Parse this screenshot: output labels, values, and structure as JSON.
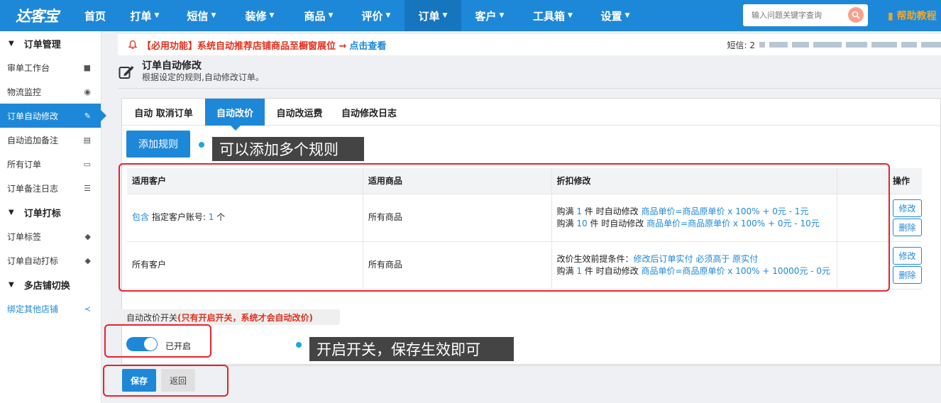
{
  "header": {
    "logo": "达客宝",
    "nav": [
      {
        "label": "首页",
        "caret": false
      },
      {
        "label": "打单",
        "caret": true
      },
      {
        "label": "短信",
        "caret": true
      },
      {
        "label": "装修",
        "caret": true
      },
      {
        "label": "商品",
        "caret": true
      },
      {
        "label": "评价",
        "caret": true
      },
      {
        "label": "订单",
        "caret": true,
        "active": true
      },
      {
        "label": "客户",
        "caret": true
      },
      {
        "label": "工具箱",
        "caret": true
      },
      {
        "label": "设置",
        "caret": true
      }
    ],
    "search_placeholder": "输入问题关键字查询",
    "help": "帮助教程",
    "caret_glyph": "▼",
    "accent_color": "#1e88d8"
  },
  "sidebar": {
    "sections": [
      {
        "title": "订单管理",
        "items": [
          {
            "label": "审单工作台",
            "icon": "truck-icon"
          },
          {
            "label": "物流监控",
            "icon": "eye-icon"
          },
          {
            "label": "订单自动修改",
            "icon": "edit-icon",
            "active": true
          },
          {
            "label": "自动追加备注",
            "icon": "list-alt-icon"
          },
          {
            "label": "所有订单",
            "icon": "card-icon"
          },
          {
            "label": "订单备注日志",
            "icon": "list-icon"
          }
        ]
      },
      {
        "title": "订单打标",
        "items": [
          {
            "label": "订单标签",
            "icon": "tags-icon"
          },
          {
            "label": "订单自动打标",
            "icon": "tags-icon"
          }
        ]
      },
      {
        "title": "多店铺切换",
        "items": [
          {
            "label": "绑定其他店铺",
            "icon": "share-icon",
            "link": true
          }
        ]
      }
    ]
  },
  "notice": {
    "text": "【必用功能】系统自动推荐店铺商品至橱窗展位 →",
    "link": "点击查看",
    "sms_label": "短信: 2"
  },
  "page": {
    "title": "订单自动修改",
    "subtitle": "根据设定的规则,自动修改订单。"
  },
  "tabs": [
    "自动 取消订单",
    "自动改价",
    "自动改运费",
    "自动修改日志"
  ],
  "add_rule_label": "添加规则",
  "callouts": {
    "add_rule": "可以添加多个规则",
    "save": "开启开关，保存生效即可"
  },
  "table": {
    "headers": [
      "适用客户",
      "适用商品",
      "折扣修改",
      "操作"
    ],
    "row1": {
      "customer_link": "包含",
      "customer_text": " 指定客户账号: ",
      "customer_count": "1",
      "customer_unit": " 个",
      "product": "所有商品",
      "l1_pre": "购满 ",
      "l1_num": "1",
      "l1_mid": " 件 时自动修改 ",
      "l1_formula": "商品单价=商品原单价 x 100% + 0元 - 1元",
      "l2_pre": "购满 ",
      "l2_num": "10",
      "l2_mid": " 件 时自动修改 ",
      "l2_formula": "商品单价=商品原单价 x 100% + 0元 - 10元"
    },
    "row2": {
      "customer": "所有客户",
      "product": "所有商品",
      "l1_pre": "改价生效前提条件：",
      "l1_formula": "修改后订单实付 必须高于 原实付",
      "l2_pre": "购满 ",
      "l2_num": "1",
      "l2_mid": " 件 时自动修改 ",
      "l2_formula": "商品单价=商品原单价 x 100% + 10000元 - 0元"
    },
    "edit_label": "修改",
    "delete_label": "删除"
  },
  "switch": {
    "label": "自动改价开关",
    "warning": "(只有开启开关，系统才会自动改价)",
    "state_text": "已开启",
    "on": true
  },
  "buttons": {
    "save": "保存",
    "back": "返回"
  }
}
